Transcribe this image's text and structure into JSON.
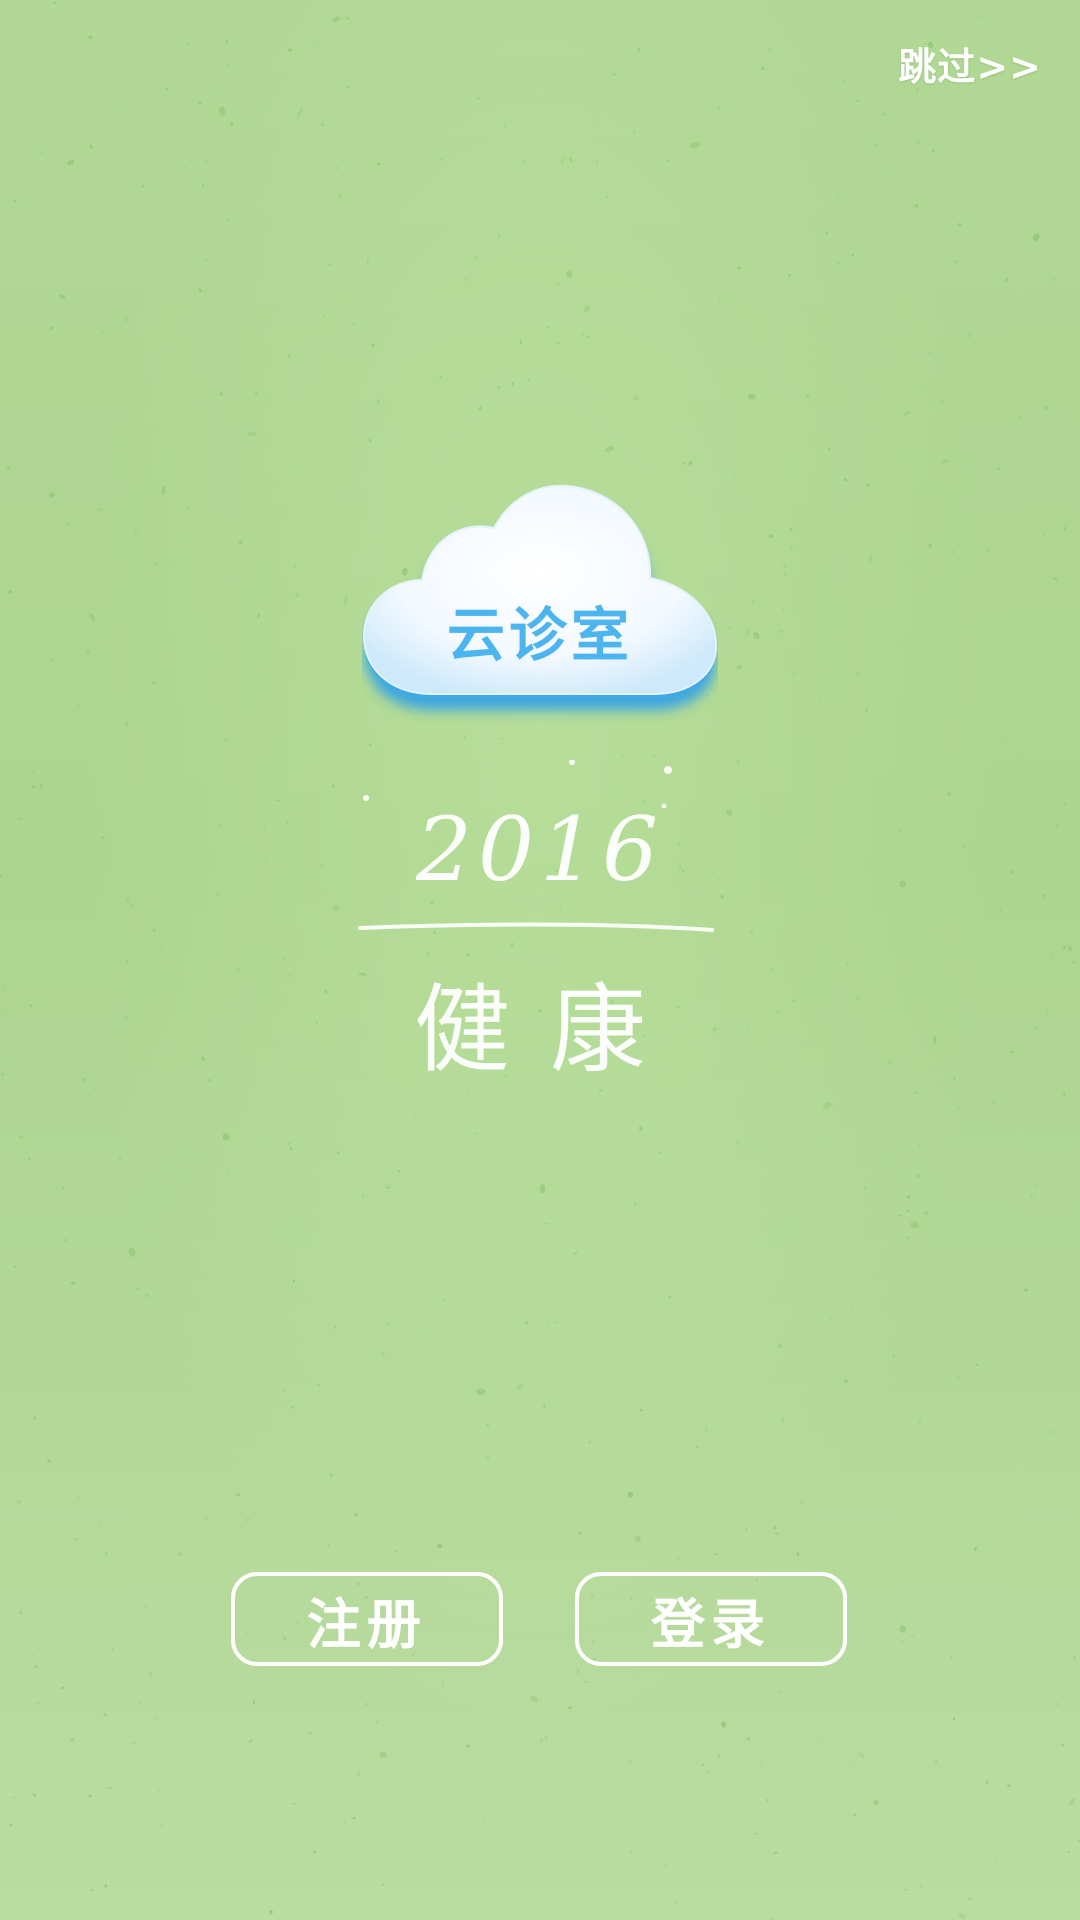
{
  "splash": {
    "skip_label": "跳过>>",
    "logo_text": "云诊室",
    "year": "2016",
    "slogan": "健康"
  },
  "actions": {
    "register_label": "注册",
    "login_label": "登录"
  },
  "colors": {
    "background": "#b2d996",
    "logo_text": "#4cb4ee",
    "cloud_shadow": "#3aa9ea",
    "button_border": "#ffffff"
  }
}
